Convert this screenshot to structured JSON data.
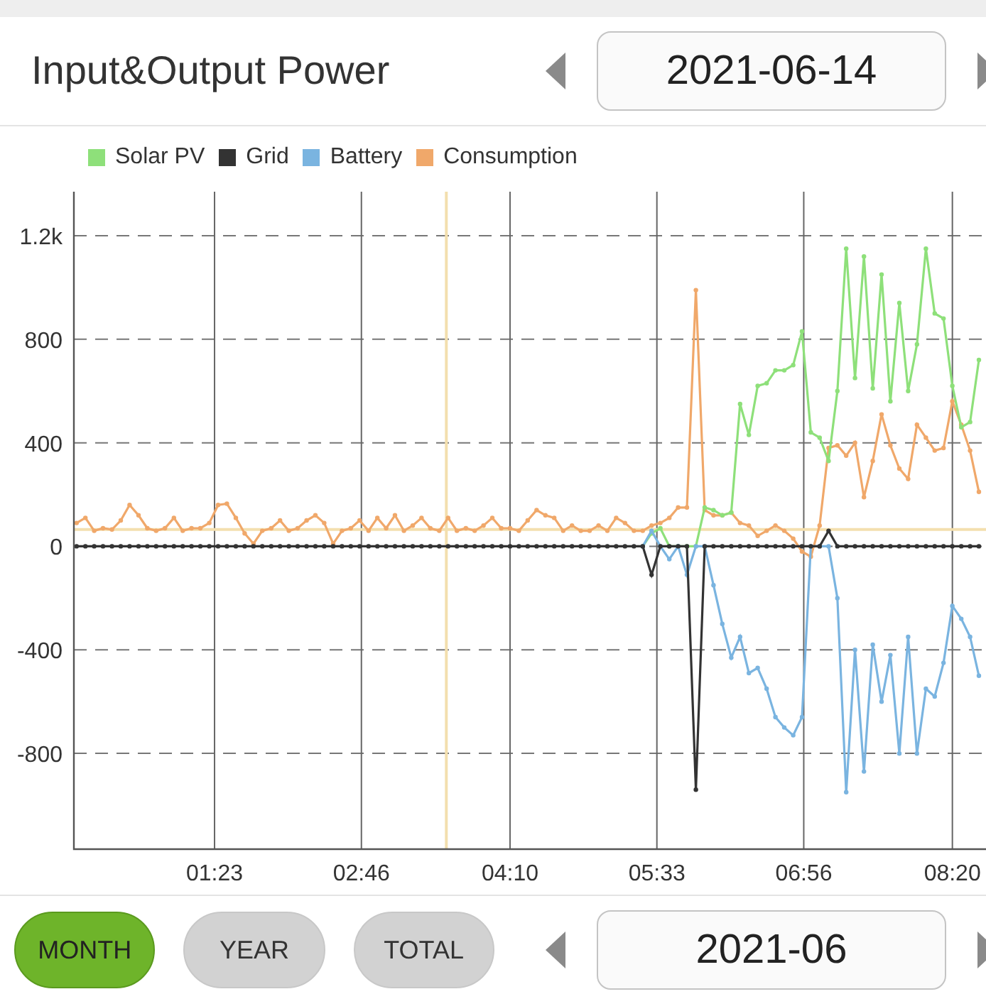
{
  "header": {
    "title": "Input&Output Power",
    "date": "2021-06-14"
  },
  "chart": {
    "chart_data": {
      "type": "line",
      "x": [
        5,
        10,
        15,
        20,
        25,
        30,
        35,
        40,
        45,
        50,
        55,
        60,
        65,
        70,
        75,
        80,
        85,
        90,
        95,
        100,
        105,
        110,
        115,
        120,
        125,
        130,
        135,
        140,
        145,
        150,
        155,
        160,
        165,
        170,
        175,
        180,
        185,
        190,
        195,
        200,
        205,
        210,
        215,
        220,
        225,
        230,
        235,
        240,
        245,
        250,
        255,
        260,
        265,
        270,
        275,
        280,
        285,
        290,
        295,
        300,
        305,
        310,
        315,
        320,
        325,
        330,
        335,
        340,
        345,
        350,
        355,
        360,
        365,
        370,
        375,
        380,
        385,
        390,
        395,
        400,
        405,
        410,
        415,
        420,
        425,
        430,
        435,
        440,
        445,
        450,
        455,
        460,
        465,
        470,
        475,
        480,
        485,
        490,
        495,
        500,
        505,
        510,
        515
      ],
      "series": [
        {
          "name": "Solar PV",
          "color": "#8ee07a",
          "values": [
            null,
            null,
            null,
            null,
            null,
            null,
            null,
            null,
            null,
            null,
            null,
            null,
            null,
            null,
            null,
            null,
            null,
            null,
            null,
            null,
            null,
            null,
            null,
            null,
            null,
            null,
            null,
            null,
            null,
            null,
            null,
            null,
            null,
            null,
            null,
            null,
            null,
            null,
            null,
            null,
            null,
            null,
            null,
            null,
            null,
            null,
            null,
            null,
            null,
            null,
            null,
            null,
            null,
            null,
            null,
            null,
            null,
            null,
            null,
            null,
            null,
            null,
            null,
            null,
            0,
            50,
            70,
            0,
            0,
            0,
            0,
            150,
            140,
            120,
            130,
            550,
            430,
            620,
            630,
            680,
            680,
            700,
            830,
            440,
            420,
            330,
            600,
            1150,
            650,
            1120,
            610,
            1050,
            560,
            940,
            600,
            780,
            1150,
            900,
            880,
            620,
            460,
            480,
            720
          ]
        },
        {
          "name": "Grid",
          "color": "#333333",
          "values": [
            0,
            0,
            0,
            0,
            0,
            0,
            0,
            0,
            0,
            0,
            0,
            0,
            0,
            0,
            0,
            0,
            0,
            0,
            0,
            0,
            0,
            0,
            0,
            0,
            0,
            0,
            0,
            0,
            0,
            0,
            0,
            0,
            0,
            0,
            0,
            0,
            0,
            0,
            0,
            0,
            0,
            0,
            0,
            0,
            0,
            0,
            0,
            0,
            0,
            0,
            0,
            0,
            0,
            0,
            0,
            0,
            0,
            0,
            0,
            0,
            0,
            0,
            0,
            0,
            0,
            -110,
            0,
            0,
            0,
            0,
            -940,
            0,
            0,
            0,
            0,
            0,
            0,
            0,
            0,
            0,
            0,
            0,
            0,
            0,
            0,
            60,
            0,
            0,
            0,
            0,
            0,
            0,
            0,
            0,
            0,
            0,
            0,
            0,
            0,
            0,
            0,
            0,
            0
          ]
        },
        {
          "name": "Battery",
          "color": "#7ab4e0",
          "values": [
            null,
            null,
            null,
            null,
            null,
            null,
            null,
            null,
            null,
            null,
            null,
            null,
            null,
            null,
            null,
            null,
            null,
            null,
            null,
            null,
            null,
            null,
            null,
            null,
            null,
            null,
            null,
            null,
            null,
            null,
            null,
            null,
            null,
            null,
            null,
            null,
            null,
            null,
            null,
            null,
            null,
            null,
            null,
            null,
            null,
            null,
            null,
            null,
            null,
            null,
            null,
            null,
            null,
            null,
            null,
            null,
            null,
            null,
            null,
            null,
            null,
            null,
            null,
            null,
            0,
            60,
            0,
            -50,
            0,
            -110,
            0,
            0,
            -150,
            -300,
            -430,
            -350,
            -490,
            -470,
            -550,
            -660,
            -700,
            -730,
            -660,
            0,
            0,
            0,
            -200,
            -950,
            -400,
            -870,
            -380,
            -600,
            -420,
            -800,
            -350,
            -800,
            -550,
            -580,
            -450,
            -230,
            -280,
            -350,
            -500
          ]
        },
        {
          "name": "Consumption",
          "color": "#f0a86a",
          "values": [
            90,
            110,
            60,
            70,
            65,
            100,
            160,
            120,
            70,
            60,
            70,
            110,
            60,
            70,
            70,
            90,
            160,
            165,
            110,
            50,
            10,
            60,
            70,
            100,
            60,
            70,
            100,
            120,
            90,
            10,
            60,
            70,
            100,
            60,
            110,
            70,
            120,
            60,
            80,
            110,
            70,
            60,
            110,
            60,
            70,
            60,
            80,
            110,
            70,
            70,
            60,
            100,
            140,
            120,
            110,
            60,
            80,
            60,
            60,
            80,
            60,
            110,
            90,
            60,
            60,
            80,
            90,
            110,
            150,
            150,
            990,
            140,
            120,
            120,
            130,
            90,
            80,
            40,
            60,
            80,
            60,
            30,
            -20,
            -40,
            80,
            380,
            390,
            350,
            400,
            190,
            330,
            510,
            390,
            300,
            260,
            470,
            420,
            370,
            380,
            560,
            470,
            370,
            210
          ]
        }
      ],
      "xlim": [
        3.5,
        519
      ],
      "ylim": [
        -1170,
        1370
      ],
      "xticks": [
        {
          "value": 83,
          "label": "01:23"
        },
        {
          "value": 166,
          "label": "02:46"
        },
        {
          "value": 250,
          "label": "04:10"
        },
        {
          "value": 333,
          "label": "05:33"
        },
        {
          "value": 416,
          "label": "06:56"
        },
        {
          "value": 500,
          "label": "08:20"
        }
      ],
      "yticks": [
        -800,
        -400,
        0,
        400,
        800,
        {
          "value": 1200,
          "label": "1.2k"
        }
      ],
      "grid": true,
      "ref_lines": [
        {
          "axis": "x",
          "value": 214,
          "color": "#f3dfae"
        },
        {
          "axis": "y",
          "value": 65,
          "color": "#f3dfae"
        }
      ]
    }
  },
  "footer": {
    "ranges": [
      {
        "label": "MONTH",
        "selected": true
      },
      {
        "label": "YEAR",
        "selected": false
      },
      {
        "label": "TOTAL",
        "selected": false
      }
    ],
    "date": "2021-06"
  }
}
